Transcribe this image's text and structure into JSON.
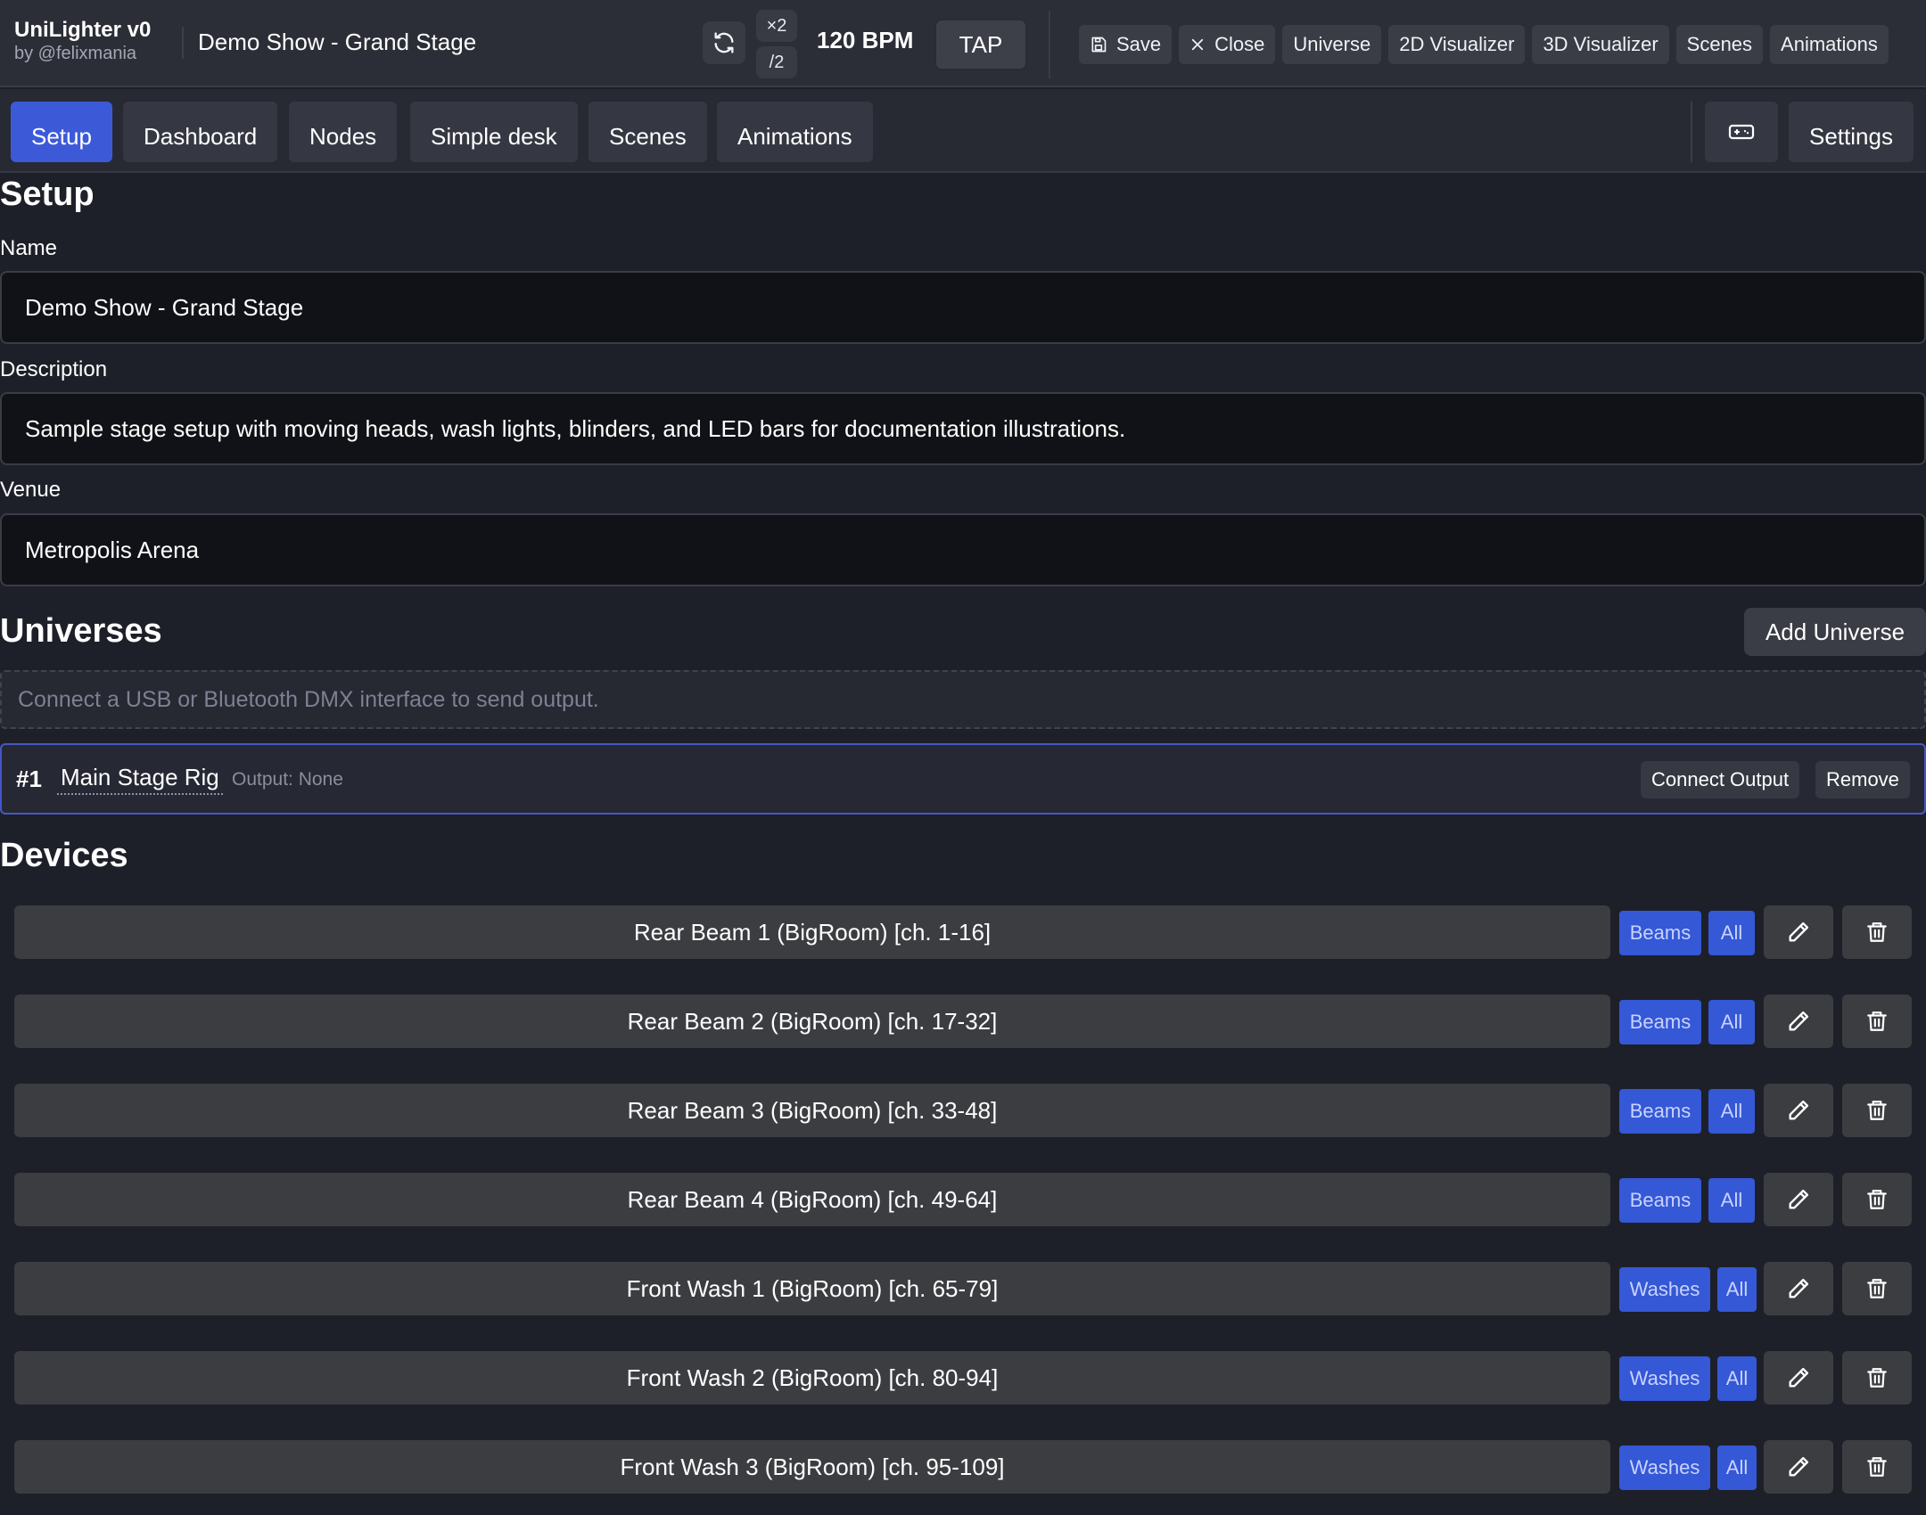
{
  "app": {
    "title": "UniLighter v0",
    "author": "by @felixmania",
    "show_title": "Demo Show - Grand Stage"
  },
  "tempo": {
    "multiply_label": "×2",
    "divide_label": "/2",
    "bpm_label": "120 BPM",
    "tap_label": "TAP"
  },
  "top_nav": [
    {
      "label": "Save",
      "icon": "save-icon"
    },
    {
      "label": "Close",
      "icon": "close-icon"
    },
    {
      "label": "Universe"
    },
    {
      "label": "2D Visualizer"
    },
    {
      "label": "3D Visualizer"
    },
    {
      "label": "Scenes"
    },
    {
      "label": "Animations"
    }
  ],
  "tabs": {
    "items": [
      "Setup",
      "Dashboard",
      "Nodes",
      "Simple desk",
      "Scenes",
      "Animations"
    ],
    "active": "Setup",
    "settings_label": "Settings"
  },
  "setup": {
    "heading": "Setup",
    "name_label": "Name",
    "name_value": "Demo Show - Grand Stage",
    "description_label": "Description",
    "description_value": "Sample stage setup with moving heads, wash lights, blinders, and LED bars for documentation illustrations.",
    "venue_label": "Venue",
    "venue_value": "Metropolis Arena"
  },
  "universes": {
    "heading": "Universes",
    "add_label": "Add Universe",
    "notice": "Connect a USB or Bluetooth DMX interface to send output.",
    "items": [
      {
        "number": "#1",
        "name": "Main Stage Rig",
        "output": "Output: None",
        "connect_label": "Connect Output",
        "remove_label": "Remove"
      }
    ]
  },
  "devices": {
    "heading": "Devices",
    "items": [
      {
        "name": "Rear Beam 1 (BigRoom) [ch. 1-16]",
        "group": "Beams",
        "scope": "All"
      },
      {
        "name": "Rear Beam 2 (BigRoom) [ch. 17-32]",
        "group": "Beams",
        "scope": "All"
      },
      {
        "name": "Rear Beam 3 (BigRoom) [ch. 33-48]",
        "group": "Beams",
        "scope": "All"
      },
      {
        "name": "Rear Beam 4 (BigRoom) [ch. 49-64]",
        "group": "Beams",
        "scope": "All"
      },
      {
        "name": "Front Wash 1 (BigRoom) [ch. 65-79]",
        "group": "Washes",
        "scope": "All"
      },
      {
        "name": "Front Wash 2 (BigRoom) [ch. 80-94]",
        "group": "Washes",
        "scope": "All"
      },
      {
        "name": "Front Wash 3 (BigRoom) [ch. 95-109]",
        "group": "Washes",
        "scope": "All"
      }
    ]
  },
  "colors": {
    "accent": "#3c5ad8",
    "tag": "#3458d6",
    "background": "#1e2029",
    "universe_border": "#4658c6"
  }
}
